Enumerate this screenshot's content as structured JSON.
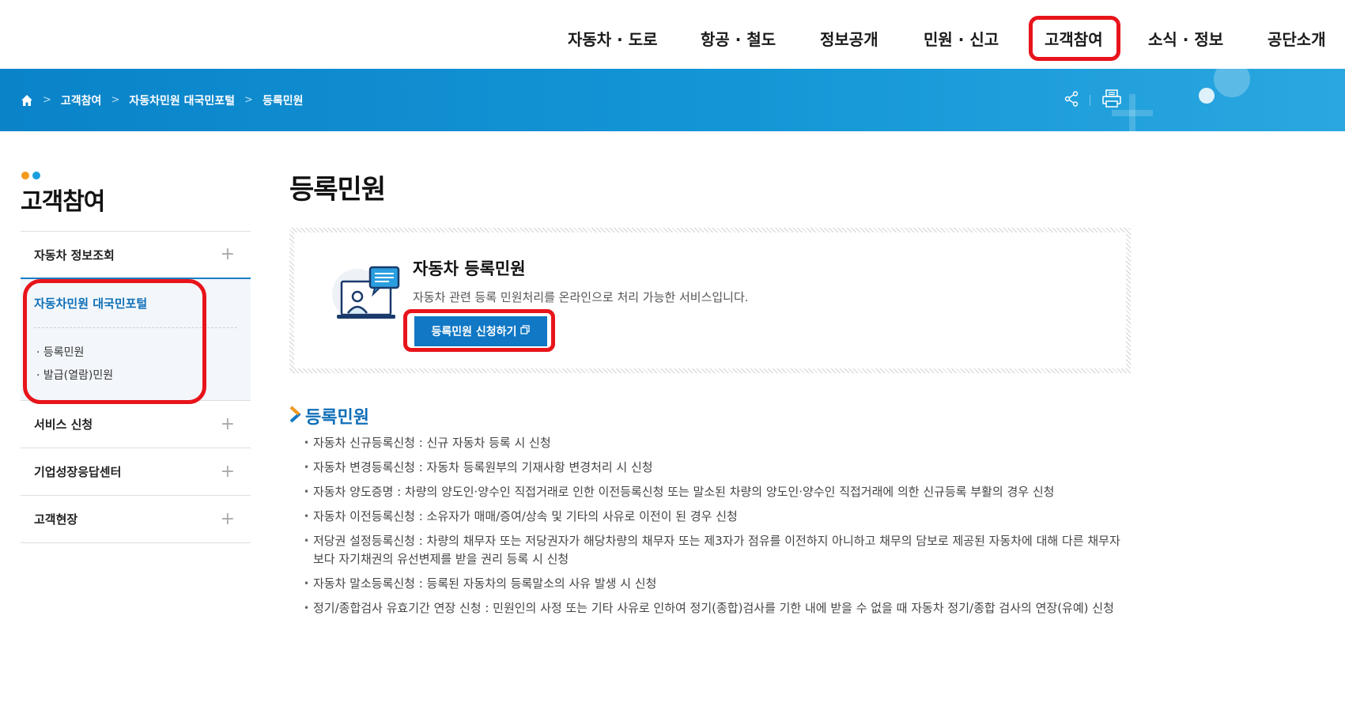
{
  "nav": {
    "items": [
      {
        "label": "자동차 · 도로"
      },
      {
        "label": "항공 · 철도"
      },
      {
        "label": "정보공개"
      },
      {
        "label": "민원 · 신고"
      },
      {
        "label": "고객참여"
      },
      {
        "label": "소식 · 정보"
      },
      {
        "label": "공단소개"
      }
    ]
  },
  "breadcrumb": {
    "home_icon": "home-icon",
    "items": [
      "고객참여",
      "자동차민원 대국민포털",
      "등록민원"
    ]
  },
  "banner_tools": {
    "share_icon": "share-icon",
    "print_icon": "print-icon"
  },
  "sidebar": {
    "title": "고객참여",
    "menu": [
      {
        "label": "자동차 정보조회"
      },
      {
        "label": "자동차민원 대국민포털",
        "children": [
          "등록민원",
          "발급(열람)민원"
        ]
      },
      {
        "label": "서비스 신청"
      },
      {
        "label": "기업성장응답센터"
      },
      {
        "label": "고객현장"
      }
    ]
  },
  "main": {
    "page_title": "등록민원",
    "service": {
      "title": "자동차 등록민원",
      "description": "자동차 관련 등록 민원처리를 온라인으로 처리 가능한 서비스입니다.",
      "button_label": "등록민원 신청하기"
    },
    "section_title": "등록민원",
    "items": [
      "자동차 신규등록신청 : 신규 자동차 등록 시 신청",
      "자동차 변경등록신청 : 자동차 등록원부의 기재사항 변경처리 시 신청",
      "자동차 양도증명 : 차량의 양도인·양수인 직접거래로 인한 이전등록신청 또는 말소된 차량의 양도인·양수인 직접거래에 의한 신규등록 부활의 경우 신청",
      "자동차 이전등록신청 : 소유자가 매매/증여/상속 및 기타의 사유로 이전이 된 경우 신청",
      "저당권 설정등록신청 : 차량의 채무자 또는 저당권자가 해당차량의 채무자 또는 제3자가 점유를 이전하지 아니하고 채무의 담보로 제공된 자동차에 대해 다른 채무자보다 자기채권의 유선변제를 받을 권리 등록 시 신청",
      "자동차 말소등록신청 : 등록된 자동차의 등록말소의 사유 발생 시 신청",
      "정기/종합검사 유효기간 연장 신청 : 민원인의 사정 또는 기타 사유로 인하여 정기(종합)검사를 기한 내에 받을 수 없을 때 자동차 정기/종합 검사의 연장(유예) 신청"
    ]
  },
  "colors": {
    "accent_blue": "#1178c5",
    "banner_blue": "#0a83c9",
    "highlight_red": "#e8141b",
    "dot_orange": "#f39a1e",
    "dot_blue": "#1aa0e0"
  }
}
